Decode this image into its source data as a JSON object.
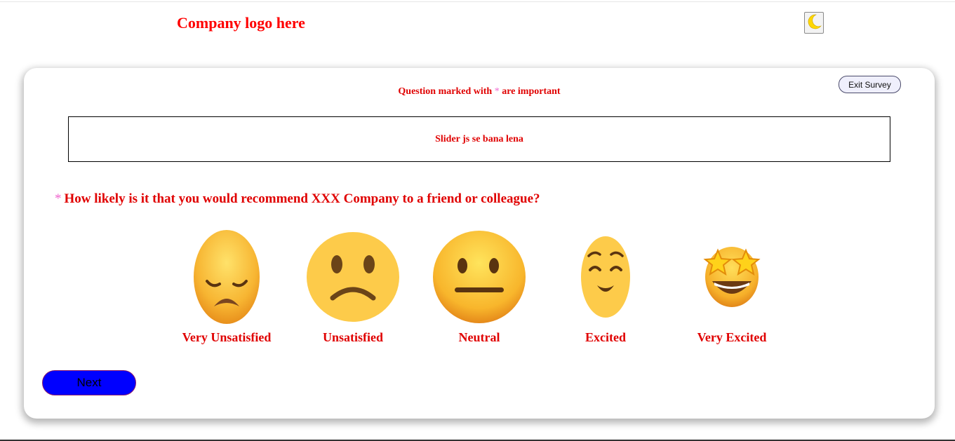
{
  "header": {
    "logo_text": "Company logo here"
  },
  "theme_toggle": {
    "icon": "moon-icon",
    "color": "#ffd700"
  },
  "survey": {
    "exit_label": "Exit Survey",
    "note_prefix": "Question marked with ",
    "note_star": "*",
    "note_suffix": " are important",
    "slider_placeholder": "Slider js se bana lena",
    "question_star": "*",
    "question": "How likely is it that you would recommend XXX Company to a friend or colleague?",
    "options": [
      {
        "label": "Very Unsatisfied",
        "icon": "disappointed-face-icon"
      },
      {
        "label": "Unsatisfied",
        "icon": "frowning-face-icon"
      },
      {
        "label": "Neutral",
        "icon": "neutral-face-icon"
      },
      {
        "label": "Excited",
        "icon": "relieved-face-icon"
      },
      {
        "label": "Very Excited",
        "icon": "star-struck-face-icon"
      }
    ],
    "next_label": "Next"
  },
  "colors": {
    "accent_text": "#ff0000",
    "star": "#f06ad0",
    "next_button": "#0000ff",
    "emoji_yellow": "#fdcb4a"
  }
}
